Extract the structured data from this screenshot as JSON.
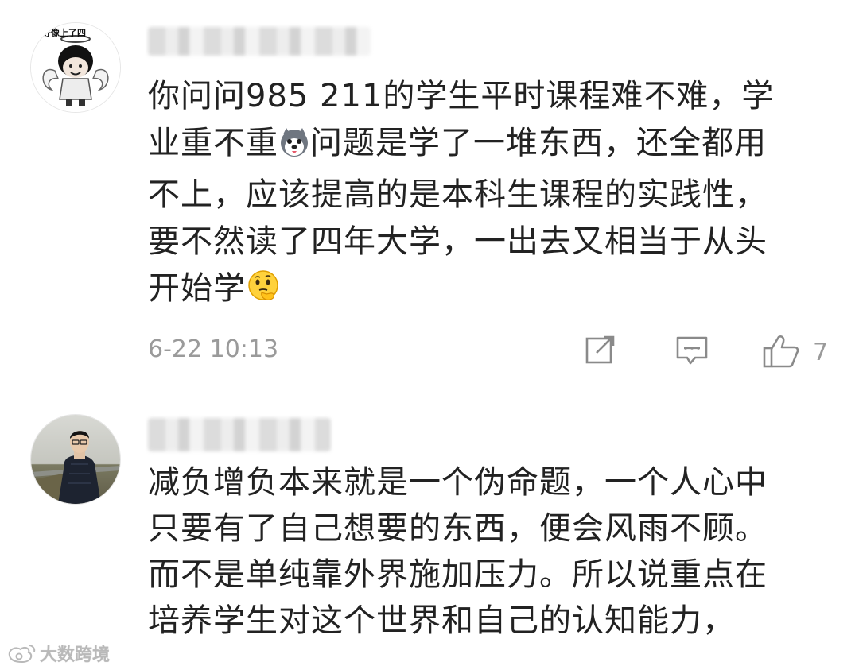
{
  "comments": [
    {
      "avatar_caption": "好像上了四",
      "text_lines": [
        "你问问985 211的学生平时课程难不难，学",
        "业重不重",
        "问题是学了一堆东西，还全都用",
        "不上，应该提高的是本科生课程的实践性，",
        "要不然读了四年大学，一出去又相当于从头",
        "开始学"
      ],
      "timestamp": "6-22 10:13",
      "actions": {
        "share_icon": "share-edit-icon",
        "reply_icon": "reply-comment-icon",
        "like_icon": "thumbs-up-icon",
        "like_count": "7"
      }
    },
    {
      "text_lines": [
        "减负增负本来就是一个伪命题，一个人心中",
        "只要有了自己想要的东西，便会风雨不顾。",
        "而不是单纯靠外界施加压力。所以说重点在",
        "培养学生对这个世界和自己的认知能力，"
      ]
    }
  ],
  "watermark": {
    "text": "大数跨境"
  },
  "colors": {
    "text": "#222222",
    "meta": "#9a9a9a",
    "divider": "#e8e8e8"
  }
}
